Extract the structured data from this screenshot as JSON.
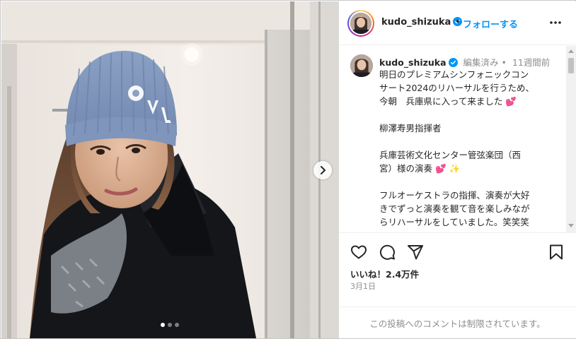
{
  "post": {
    "username": "kudo_shizuka",
    "header_separator": "•",
    "follow_label": "フォローする",
    "caption_meta": {
      "username": "kudo_shizuka",
      "edited_label": "編集済み •",
      "time_ago": "11週間前"
    },
    "caption_lines": [
      "明日のプレミアムシンフォニックコン",
      "サート2024のリハーサルを行うため、",
      "今朝　兵庫県に入って来ました 💕",
      "",
      "柳澤寿男指揮者",
      "",
      "兵庫芸術文化センター管弦楽団（西",
      "宮）様の演奏 💕 ✨",
      "",
      "フルオーケストラの指揮、演奏が大好",
      "きでずっと演奏を観て音を楽しみなが",
      "らリハーサルをしていました。笑笑笑"
    ],
    "likes_label": "いいね！2.4万件",
    "date_label": "3月1日",
    "comments_disabled": "この投稿へのコメントは制限されています。",
    "carousel": {
      "count": 3,
      "active_index": 0
    }
  },
  "colors": {
    "accent": "#0095f6",
    "verified": "#0095f6",
    "text": "#262626",
    "muted": "#8e8e8e",
    "heart_emoji": "#e8336b"
  },
  "icons": {
    "like": "heart-icon",
    "comment": "comment-icon",
    "share": "share-icon",
    "save": "bookmark-icon",
    "more": "more-horizontal-icon",
    "next": "chevron-right-icon",
    "verified": "verified-badge-icon"
  }
}
